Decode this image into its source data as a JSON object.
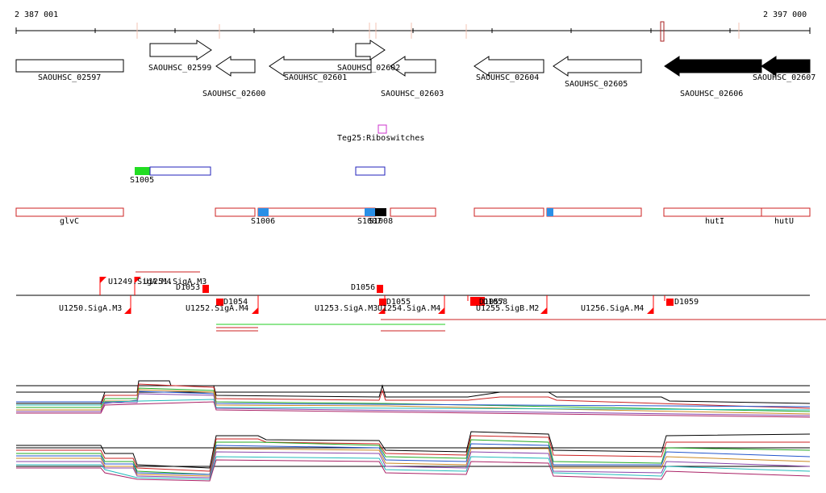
{
  "coords": {
    "start": "2 387 001",
    "end": "2 397 000"
  },
  "genes": [
    "SAOUHSC_02597",
    "SAOUHSC_02599",
    "SAOUHSC_02600",
    "SAOUHSC_02601",
    "SAOUHSC_02602",
    "SAOUHSC_02603",
    "SAOUHSC_02604",
    "SAOUHSC_02605",
    "SAOUHSC_02606",
    "SAOUHSC_02607"
  ],
  "riboswitch": "Teg25:Riboswitches",
  "srnas": [
    "S1005",
    "S1006",
    "S1007",
    "S1008"
  ],
  "operons": [
    "glvC",
    "hutI",
    "hutU"
  ],
  "promoters": [
    "U1249.SigA.M4",
    "U1250.SigA.M3",
    "U1251.SigA.M3",
    "U1252.SigA.M4",
    "U1253.SigA.M3",
    "U1254.SigA.M4",
    "U1255.SigB.M2",
    "U1256.SigA.M4"
  ],
  "terminators": [
    "D1053",
    "D1054",
    "D1055",
    "D1056",
    "D1057",
    "D1058",
    "D1059"
  ],
  "colors": {
    "gene_outline": "#000000",
    "gene_fill_dark": "#000000",
    "riboswitch": "#cc33cc",
    "srna_blue": "#2222bb",
    "srna_green": "#22dd22",
    "operon_red": "#cc2222",
    "marker_blue": "#2a8fe6",
    "terminator_red": "#ff0000",
    "expr_green": "#22cc22"
  }
}
